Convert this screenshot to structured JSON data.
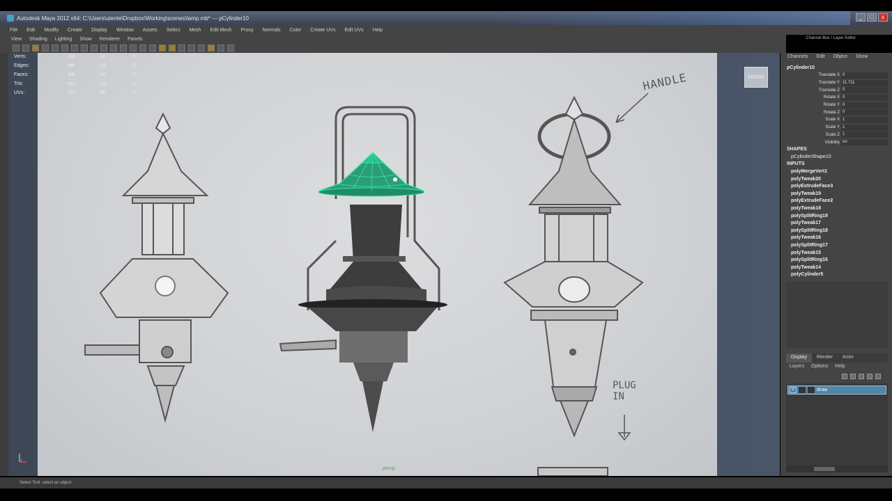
{
  "window": {
    "title": "Autodesk Maya 2012 x64: C:\\Users\\utente\\Dropbox\\Working\\scenes\\lamp.mb* --- pCylinder10",
    "controls": [
      "_",
      "□",
      "x"
    ]
  },
  "menubar": {
    "items": [
      "File",
      "Edit",
      "Modify",
      "Create",
      "Display",
      "Window",
      "Assets",
      "Select",
      "Mesh",
      "Edit Mesh",
      "Proxy",
      "Normals",
      "Color",
      "Create UVs",
      "Edit UVs",
      "Help"
    ],
    "right_label": "Channel Box / Layer Editor"
  },
  "viewport_menu": [
    "View",
    "Shading",
    "Lighting",
    "Show",
    "Renderer",
    "Panels"
  ],
  "hud": {
    "rows": [
      {
        "label": "Verts:",
        "a": "264",
        "b": "55",
        "c": "0"
      },
      {
        "label": "Edges:",
        "a": "644",
        "b": "120",
        "c": "0"
      },
      {
        "label": "Faces:",
        "a": "308",
        "b": "54",
        "c": "0"
      },
      {
        "label": "Tris:",
        "a": "612",
        "b": "112",
        "c": "0"
      },
      {
        "label": "UVs:",
        "a": "377",
        "b": "86",
        "c": "0"
      }
    ]
  },
  "viewport": {
    "camera_label": "persp",
    "view_cube_label": "FRONT",
    "annotations": {
      "handle": "HANDLE",
      "plug_line1": "PLUG",
      "plug_line2": "IN"
    }
  },
  "channel_box": {
    "tabs": [
      "Channels",
      "Edit",
      "Object",
      "Show"
    ],
    "object_name": "pCylinder10",
    "channels": [
      {
        "name": "Translate X",
        "value": "0"
      },
      {
        "name": "Translate Y",
        "value": "11.711"
      },
      {
        "name": "Translate Z",
        "value": "0"
      },
      {
        "name": "Rotate X",
        "value": "0"
      },
      {
        "name": "Rotate Y",
        "value": "0"
      },
      {
        "name": "Rotate Z",
        "value": "0"
      },
      {
        "name": "Scale X",
        "value": "1"
      },
      {
        "name": "Scale Y",
        "value": "1"
      },
      {
        "name": "Scale Z",
        "value": "1"
      },
      {
        "name": "Visibility",
        "value": "on"
      }
    ],
    "shapes_header": "SHAPES",
    "shape_node": "pCylinderShape10",
    "inputs_header": "INPUTS",
    "inputs": [
      "polyMergeVert1",
      "polyTweak20",
      "polyExtrudeFace3",
      "polyTweak19",
      "polyExtrudeFace2",
      "polyTweak18",
      "polySplitRing19",
      "polyTweak17",
      "polySplitRing18",
      "polyTweak16",
      "polySplitRing17",
      "polyTweak15",
      "polySplitRing16",
      "polyTweak14",
      "polyCylinder5"
    ]
  },
  "layer_editor": {
    "tabs": [
      "Display",
      "Render",
      "Anim"
    ],
    "menu": [
      "Layers",
      "Options",
      "Help"
    ],
    "layers": [
      {
        "visibility": "V",
        "name": "draw"
      }
    ]
  },
  "helpline": "Select Tool: select an object",
  "colors": {
    "selection_wire": "#2fb88a",
    "layer_highlight": "#5285a6",
    "ui_bg": "#444444"
  }
}
